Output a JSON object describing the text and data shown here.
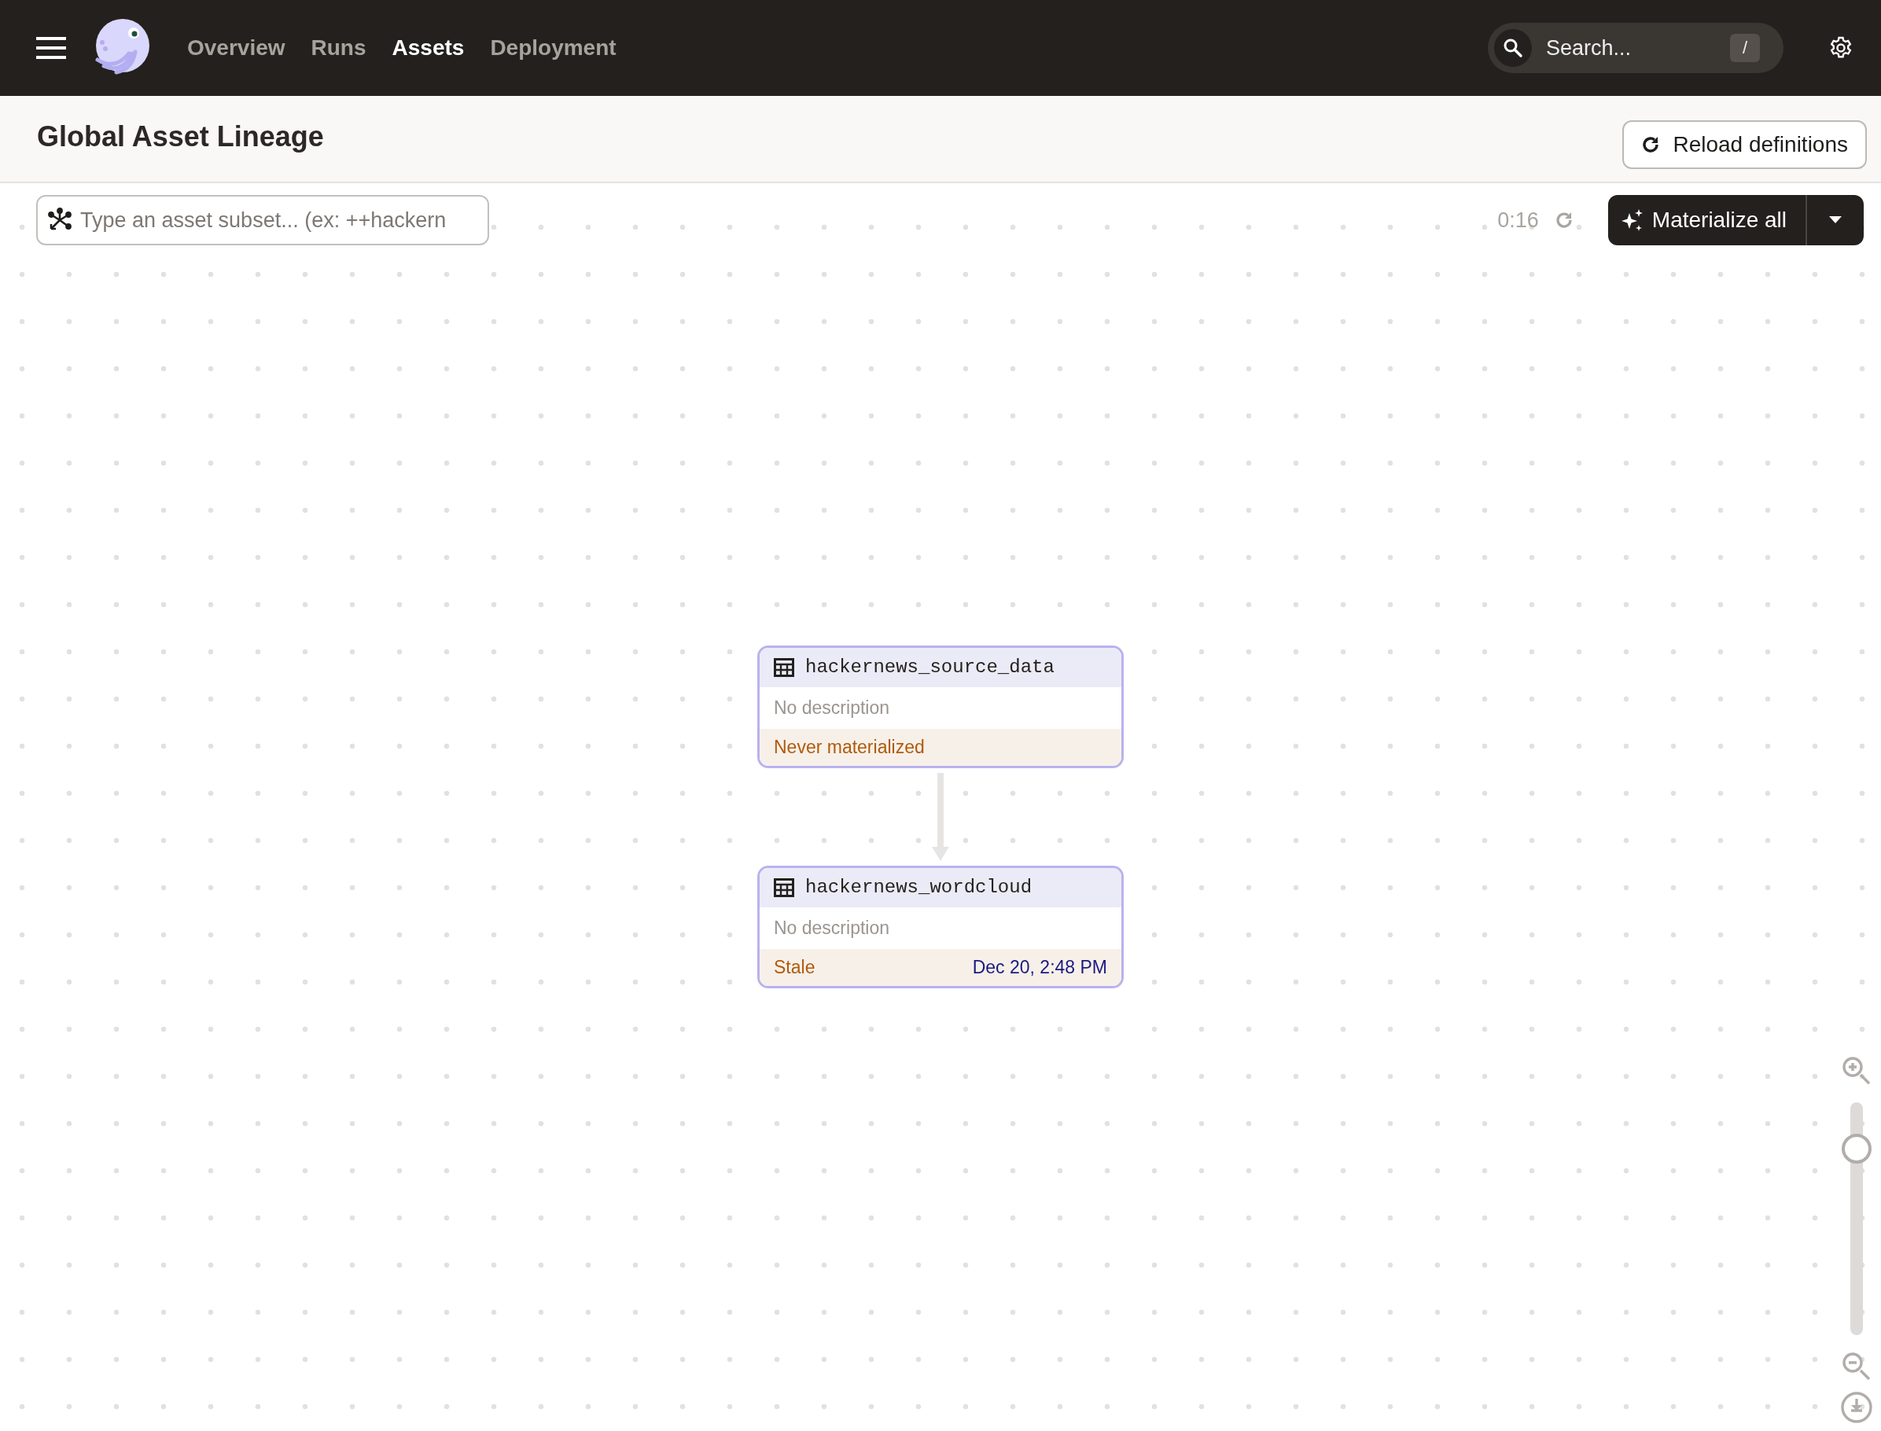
{
  "nav": {
    "tabs": [
      {
        "label": "Overview",
        "selected": false
      },
      {
        "label": "Runs",
        "selected": false
      },
      {
        "label": "Assets",
        "selected": true
      },
      {
        "label": "Deployment",
        "selected": false
      }
    ]
  },
  "search": {
    "placeholder": "Search...",
    "shortcut": "/"
  },
  "page": {
    "title": "Global Asset Lineage",
    "reload_button": "Reload definitions"
  },
  "toolbar": {
    "filter": {
      "placeholder": "Type an asset subset... (ex: ++hackern"
    },
    "refresh_timer": "0:16",
    "materialize_button": "Materialize all"
  },
  "graph": {
    "nodes": [
      {
        "name": "hackernews_source_data",
        "description": "No description",
        "status": "Never materialized",
        "incoming_edge": false
      },
      {
        "name": "hackernews_wordcloud",
        "description": "No description",
        "status": "Stale",
        "timestamp": "Dec 20, 2:48 PM",
        "incoming_edge": true
      }
    ]
  },
  "zoom": {
    "level": 0.8
  }
}
